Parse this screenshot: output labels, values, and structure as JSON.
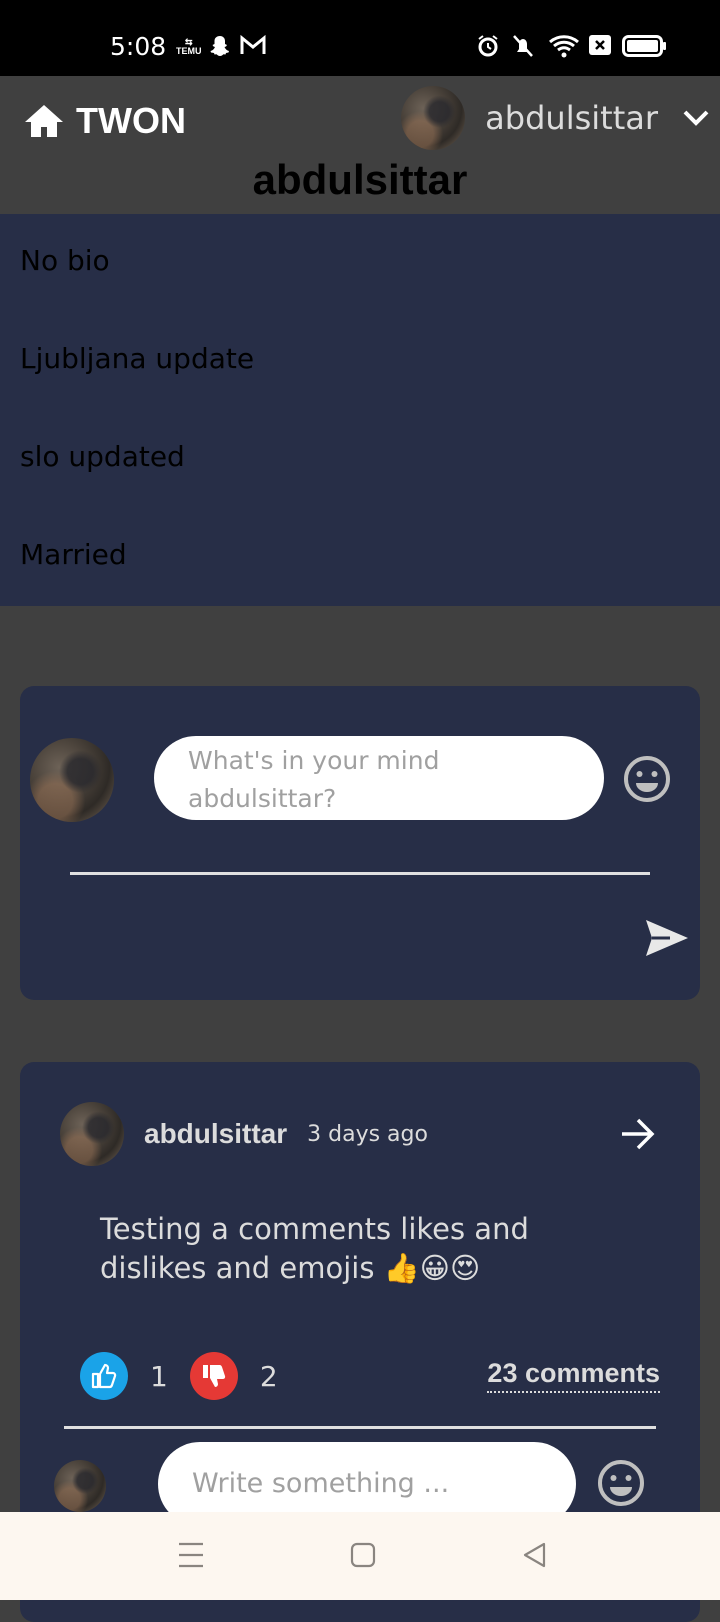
{
  "status_bar": {
    "time": "5:08",
    "temu_badge": "TEMU",
    "icons": [
      "temu-icon",
      "snapchat-icon",
      "gmail-icon",
      "alarm-icon",
      "mute-icon",
      "wifi-icon",
      "close-box-icon",
      "battery-icon"
    ]
  },
  "header": {
    "brand": "TWON",
    "username": "abdulsittar",
    "home_icon": "home-icon",
    "dropdown_icon": "chevron-down-icon"
  },
  "profile": {
    "title": "abdulsittar",
    "bio": "No bio",
    "location": "Ljubljana update",
    "country": "slo updated",
    "relationship": "Married"
  },
  "composer": {
    "placeholder_line1": "What's in your mind",
    "placeholder_line2": "abdulsittar?",
    "emoji_icon": "emoji-icon",
    "send_icon": "send-icon"
  },
  "post": {
    "author": "abdulsittar",
    "time": "3 days ago",
    "text_line1": "Testing a comments likes and",
    "text_line2": "dislikes and emojis 👍😀😍",
    "likes": "1",
    "dislikes": "2",
    "comments": "23 comments",
    "comment_placeholder": "Write something ...",
    "open_icon": "arrow-right-icon"
  },
  "colors": {
    "panel": "#272e47",
    "background": "#404040",
    "like": "#1aa3e8",
    "dislike": "#e53935"
  },
  "nav_bar": {
    "icons": [
      "menu-icon",
      "home-square-icon",
      "back-triangle-icon"
    ]
  }
}
